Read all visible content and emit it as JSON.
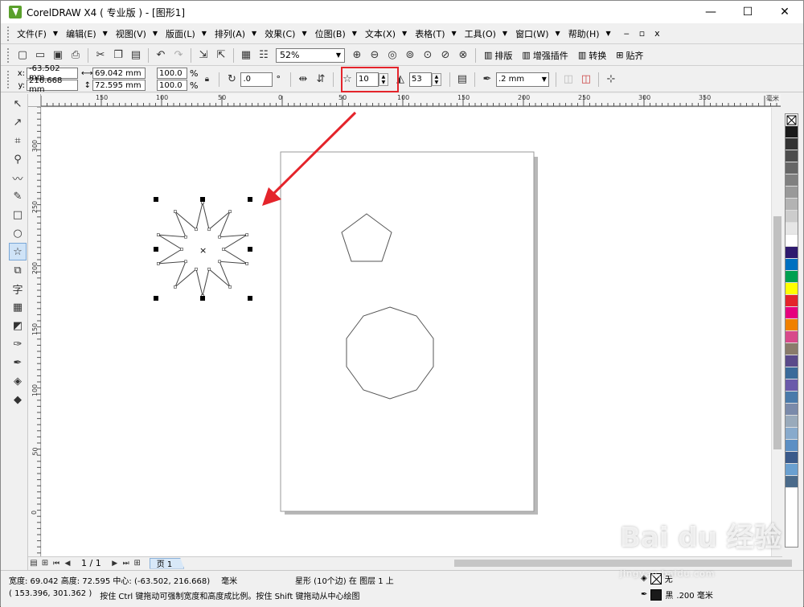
{
  "window": {
    "title": "CorelDRAW X4 ( 专业版 ) - [图形1]",
    "min": "—",
    "max": "☐",
    "close": "✕"
  },
  "menu": {
    "items": [
      "文件(F)",
      "编辑(E)",
      "视图(V)",
      "版面(L)",
      "排列(A)",
      "效果(C)",
      "位图(B)",
      "文本(X)",
      "表格(T)",
      "工具(O)",
      "窗口(W)",
      "帮助(H)"
    ],
    "doc_controls": [
      "‒",
      "▫",
      "x"
    ]
  },
  "standard_toolbar": {
    "zoom": "52%",
    "buttons": [
      "排版",
      "增强插件",
      "转换",
      "贴齐"
    ]
  },
  "property_bar": {
    "x": "-63.502 mm",
    "y": "216.668 mm",
    "width": "69.042 mm",
    "height": "72.595 mm",
    "scale_x": "100.0",
    "scale_y": "100.0",
    "percent": "%",
    "rotation": ".0",
    "degree": "°",
    "points": "10",
    "sharpness": "53",
    "outline_width": ".2 mm"
  },
  "rulers": {
    "h_labels": [
      "150",
      "100",
      "50",
      "0",
      "50",
      "100",
      "150",
      "200",
      "250",
      "300",
      "350"
    ],
    "h_unit": "毫米",
    "v_labels": [
      "300",
      "250",
      "200",
      "150",
      "100",
      "50",
      "0"
    ]
  },
  "page_nav": {
    "counter": "1 / 1",
    "tab": "页 1"
  },
  "status": {
    "dims": "宽度: 69.042 高度: 72.595 中心: (-63.502, 216.668)",
    "unit": "毫米",
    "object": "星形 (10个边) 在 图层 1 上",
    "coords": "( 153.396, 301.362 )",
    "hint": "按住 Ctrl 键拖动可强制宽度和高度成比例。按住 Shift 键拖动从中心绘图",
    "fill": "无",
    "outline_color": "黑",
    "outline_width": ".200 毫米"
  },
  "watermark": {
    "text": "Bai du 经验",
    "sub": "jingyan.baidu.com"
  },
  "colors": {
    "accent_red": "#e4242b"
  }
}
